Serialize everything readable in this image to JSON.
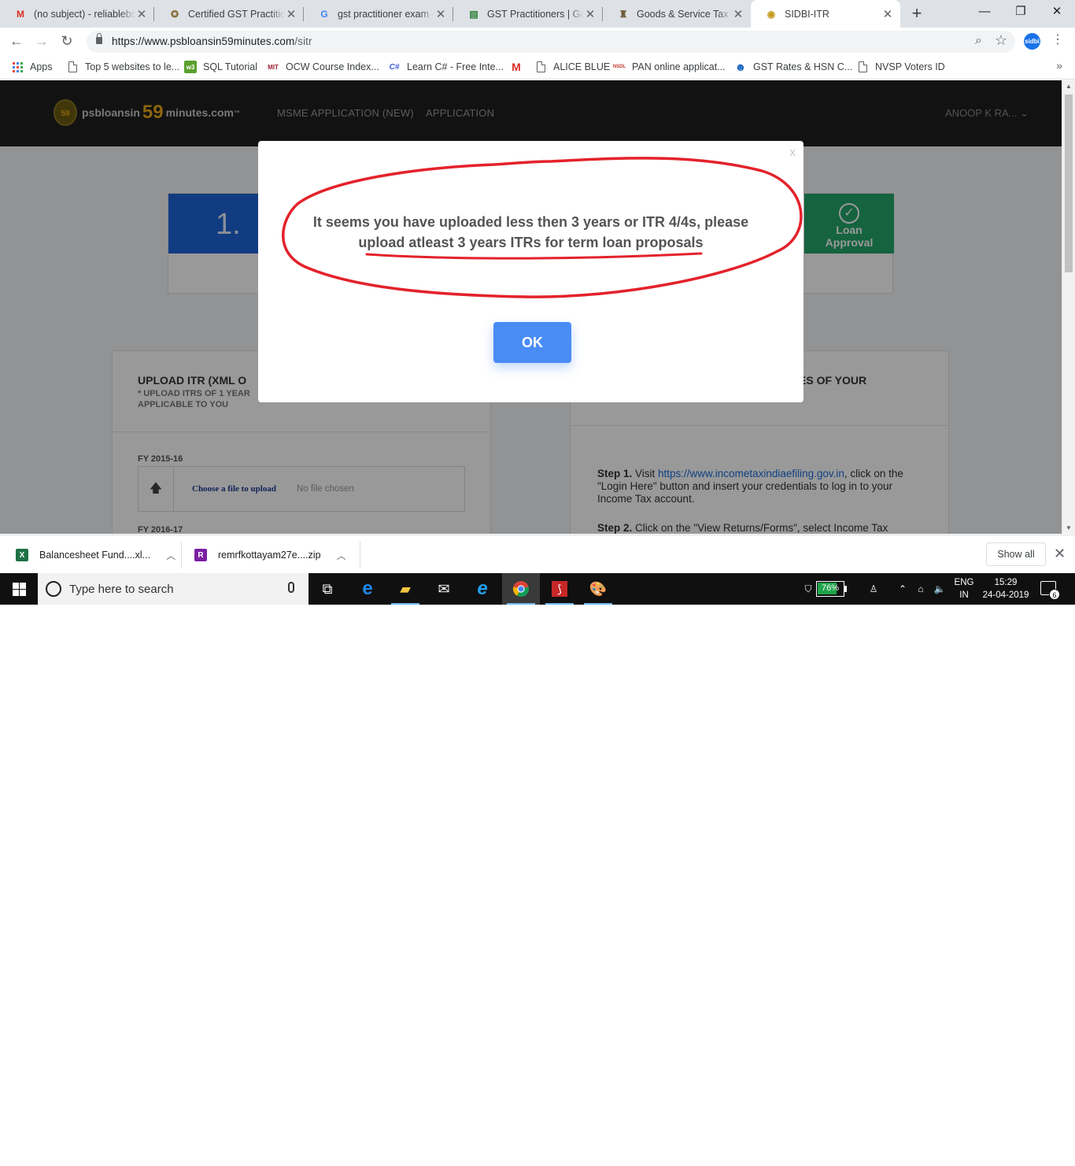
{
  "tabs": [
    {
      "title": "(no subject) - reliablebs",
      "icon": "gmail-icon",
      "active": false
    },
    {
      "title": "Certified GST Practition",
      "icon": "certificate-icon",
      "active": false
    },
    {
      "title": "gst practitioner exam - ",
      "icon": "google-icon",
      "active": false
    },
    {
      "title": "GST Practitioners | Goo",
      "icon": "gst-icon",
      "active": false
    },
    {
      "title": "Goods & Service Tax (G",
      "icon": "emblem-icon",
      "active": false
    },
    {
      "title": "SIDBI-ITR",
      "icon": "sidbi-icon",
      "active": true
    }
  ],
  "address_bar": {
    "url_host": "https://www.psbloansin59minutes.com",
    "url_path": "/sitr"
  },
  "extension": {
    "label": "sidbi"
  },
  "bookmarks": [
    {
      "label": "Apps",
      "icon": "apps-grid-icon"
    },
    {
      "label": "Top 5 websites to le...",
      "icon": "page-icon"
    },
    {
      "label": "SQL Tutorial",
      "icon": "sql-icon"
    },
    {
      "label": "OCW Course Index...",
      "icon": "mit-icon"
    },
    {
      "label": "Learn C# - Free Inte...",
      "icon": "csharp-icon"
    },
    {
      "label": "",
      "icon": "gmail-icon"
    },
    {
      "label": "ALICE BLUE",
      "icon": "page-icon"
    },
    {
      "label": "PAN online applicat...",
      "icon": "nsdl-icon"
    },
    {
      "label": "GST Rates & HSN C...",
      "icon": "gst-rates-icon"
    },
    {
      "label": "NVSP Voters ID",
      "icon": "page-icon"
    }
  ],
  "site": {
    "logo": {
      "part1": "psbloansin",
      "part2": "59",
      "part3": "minutes.com",
      "tm": "™",
      "badge": "59"
    },
    "nav": [
      "MSME APPLICATION (NEW)",
      "APPLICATION"
    ],
    "user": "ANOOP K RA...",
    "steps": {
      "first_number": "1.",
      "last_label_line1": "Loan",
      "last_label_line2": "Approval"
    },
    "left_card": {
      "title": "UPLOAD ITR (XML O",
      "subtitle": "* UPLOAD ITRS OF 1 YEAR\nAPPLICABLE TO YOU",
      "fy1": "FY 2015-16",
      "fy2": "FY 2016-17",
      "choose_file": "Choose a file to upload",
      "no_file": "No file chosen"
    },
    "right_card": {
      "title": "ES OF YOUR",
      "step1_label": "Step 1.",
      "step1_pre": " Visit ",
      "step1_link": "https://www.incometaxindiaefiling.gov.in",
      "step1_post": ", click on the \"Login Here\" button and insert your credentials to log in to your Income Tax account.",
      "step2_label": "Step 2.",
      "step2_text": " Click on the \"View Returns/Forms\", select Income Tax"
    }
  },
  "modal": {
    "close": "x",
    "message": "It seems you have uploaded less then 3 years or ITR 4/4s, please upload atleast 3 years ITRs for term loan proposals",
    "ok": "OK",
    "annotation_color": "#e3222b"
  },
  "downloads": [
    {
      "name": "Balancesheet Fund....xl...",
      "icon": "excel-file-icon"
    },
    {
      "name": "remrfkottayam27e....zip",
      "icon": "winrar-file-icon"
    }
  ],
  "downloads_show_all": "Show all",
  "taskbar": {
    "search_placeholder": "Type here to search",
    "battery_percent": 76,
    "battery_label": "76%",
    "lang_line1": "ENG",
    "lang_line2": "IN",
    "time": "15:29",
    "date": "24-04-2019",
    "notifications": "6"
  }
}
